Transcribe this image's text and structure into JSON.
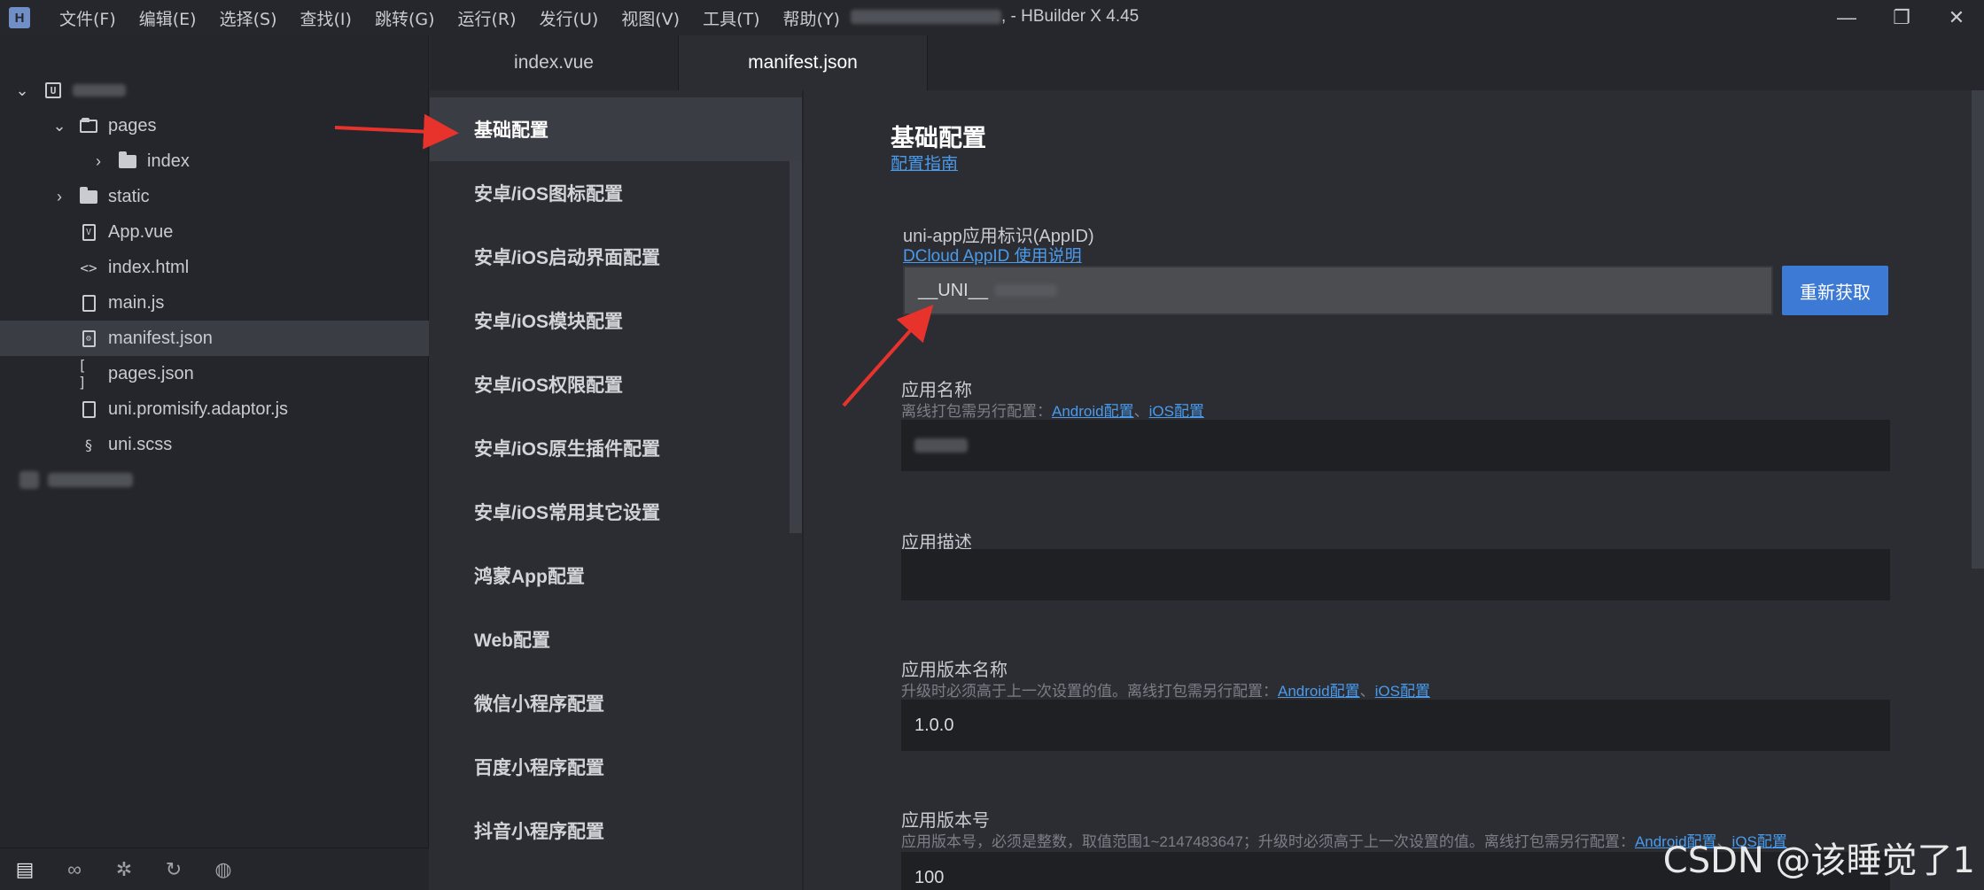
{
  "titlebar": {
    "menus": [
      "文件(F)",
      "编辑(E)",
      "选择(S)",
      "查找(I)",
      "跳转(G)",
      "运行(R)",
      "发行(U)",
      "视图(V)",
      "工具(T)",
      "帮助(Y)"
    ],
    "title_suffix": ", - HBuilder X 4.45",
    "controls": {
      "minimize": "—",
      "restore": "❐",
      "close": "✕"
    }
  },
  "tree": {
    "pages": "pages",
    "index": "index",
    "static": "static",
    "app_vue": "App.vue",
    "index_html": "index.html",
    "main_js": "main.js",
    "manifest": "manifest.json",
    "pages_json": "pages.json",
    "promisify": "uni.promisify.adaptor.js",
    "uni_scss": "uni.scss"
  },
  "tabs": [
    "index.vue",
    "manifest.json"
  ],
  "nav": [
    "基础配置",
    "安卓/iOS图标配置",
    "安卓/iOS启动界面配置",
    "安卓/iOS模块配置",
    "安卓/iOS权限配置",
    "安卓/iOS原生插件配置",
    "安卓/iOS常用其它设置",
    "鸿蒙App配置",
    "Web配置",
    "微信小程序配置",
    "百度小程序配置",
    "抖音小程序配置"
  ],
  "form": {
    "title": "基础配置",
    "guide_link": "配置指南",
    "appid": {
      "label": "uni-app应用标识(AppID)",
      "help_link": "DCloud AppID 使用说明",
      "value": "__UNI__",
      "button": "重新获取"
    },
    "app_name": {
      "label": "应用名称",
      "hint": "离线打包需另行配置：",
      "link_android": "Android配置",
      "sep": "、",
      "link_ios": "iOS配置"
    },
    "app_desc": {
      "label": "应用描述",
      "value": ""
    },
    "version_name": {
      "label": "应用版本名称",
      "hint": "升级时必须高于上一次设置的值。离线打包需另行配置：",
      "link_android": "Android配置",
      "sep": "、",
      "link_ios": "iOS配置",
      "value": "1.0.0"
    },
    "version_code": {
      "label": "应用版本号",
      "hint": "应用版本号，必须是整数，取值范围1~2147483647；升级时必须高于上一次设置的值。离线打包需另行配置：",
      "link_android": "Android配置",
      "sep": "、",
      "link_ios": "iOS配置",
      "value": "100"
    }
  },
  "watermark": "CSDN @该睡觉了1",
  "colors": {
    "accent": "#3d7ad6",
    "link": "#4a9bec",
    "arrow": "#e8322c"
  }
}
